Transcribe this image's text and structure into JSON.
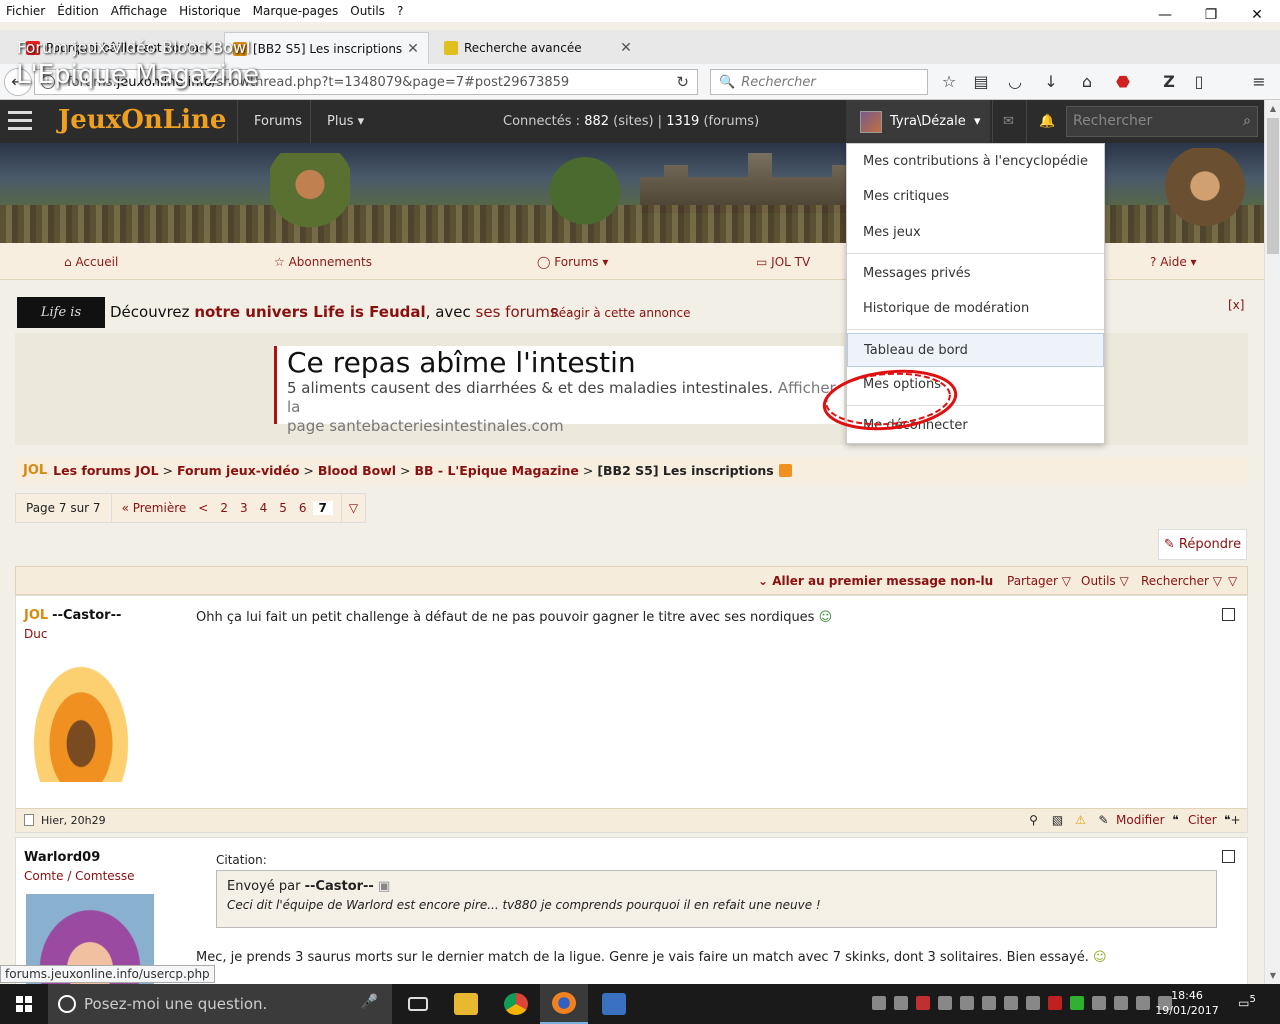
{
  "menubar": [
    "Fichier",
    "Édition",
    "Affichage",
    "Historique",
    "Marque-pages",
    "Outils",
    "?"
  ],
  "tabs": [
    {
      "label": "Pourquoi bâiller est conta...",
      "favicon_color": "#e02020",
      "active": false
    },
    {
      "label": "[BB2 S5] Les inscriptions - ...",
      "favicon_color": "#d88a10",
      "active": true
    },
    {
      "label": "Recherche avancée",
      "favicon_color": "#e0c020",
      "active": false
    }
  ],
  "urlbar": {
    "prefix": "forums.",
    "domain": "jeuxonline.info",
    "path": "/showthread.php?t=1348079&page=7#post29673859"
  },
  "searchbar": {
    "placeholder": "Rechercher"
  },
  "site": {
    "logo": "JeuxOnLine",
    "nav_forums": "Forums",
    "nav_plus": "Plus",
    "online_label": "Connectés :",
    "online_sites": "882",
    "online_sites_label": "(sites) |",
    "online_forums": "1319",
    "online_forums_label": "(forums)",
    "user": "Tyra\\Dézale",
    "search_placeholder": "Rechercher"
  },
  "banner": {
    "crumb1": "Forum jeux-vidéo",
    "crumb2": "Blood Bowl",
    "title": "L'Epique Magazine"
  },
  "subnav": [
    "Accueil",
    "Abonnements",
    "Forums",
    "JOL TV",
    "Aide"
  ],
  "ad": {
    "logo": "Life is Feudal",
    "text_pre": "Découvrez",
    "text_bold": "notre univers Life is Feudal",
    "text_mid": ", avec",
    "text_link": "ses forums",
    "text_sep": "-",
    "react": "Réagir à cette annonce",
    "close": "[x]",
    "title": "Ce repas abîme l'intestin",
    "line1": "5 aliments causent des diarrhées & et des maladies intestinales.",
    "line1_tail": "Afficher la",
    "line2": "page santebacteriesintestinales.com"
  },
  "breadcrumb": {
    "jol": "JOL",
    "items": [
      "Les forums JOL",
      "Forum jeux-vidéo",
      "Blood Bowl",
      "BB - L'Epique Magazine"
    ],
    "current": "[BB2 S5] Les inscriptions"
  },
  "pager": {
    "info": "Page 7 sur 7",
    "first": "« Première",
    "prev": "<",
    "pages": [
      "2",
      "3",
      "4",
      "5",
      "6"
    ],
    "current": "7"
  },
  "reply": "Répondre",
  "tools": {
    "unread": "Aller au premier message non-lu",
    "share": "Partager",
    "tools": "Outils",
    "search": "Rechercher"
  },
  "post1": {
    "user": "--Castor--",
    "rank": "Duc",
    "text": "Ohh ça lui fait un petit challenge à défaut de ne pas pouvoir gagner le titre avec ses nordiques",
    "date": "Hier, 20h29",
    "edit": "Modifier",
    "quote": "Citer"
  },
  "post2": {
    "user": "Warlord09",
    "rank": "Comte / Comtesse",
    "citation_label": "Citation:",
    "quote_by_pre": "Envoyé par",
    "quote_by": "--Castor--",
    "quote_text": "Ceci dit l'équipe de Warlord est encore pire... tv880 je comprends pourquoi il en refait une neuve !",
    "text": "Mec, je prends 3 saurus morts sur le dernier match de la ligue. Genre je vais faire un match avec 7 skinks, dont 3 solitaires. Bien essayé."
  },
  "dropdown": [
    "Mes contributions à l'encyclopédie",
    "Mes critiques",
    "Mes jeux",
    "Messages privés",
    "Historique de modération",
    "Tableau de bord",
    "Mes options",
    "Me déconnecter"
  ],
  "status_url": "forums.jeuxonline.info/usercp.php",
  "taskbar": {
    "search_placeholder": "Posez-moi une question.",
    "time": "18:46",
    "date": "19/01/2017",
    "notifications": "5"
  }
}
